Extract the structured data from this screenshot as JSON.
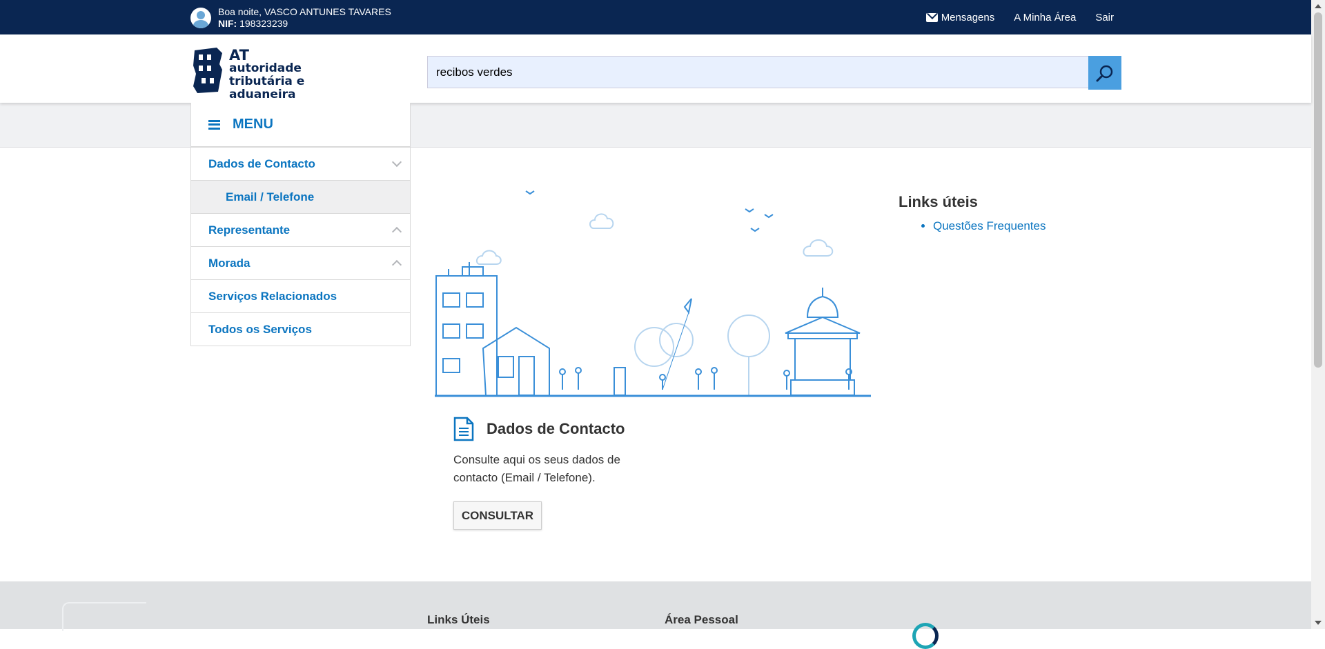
{
  "topbar": {
    "greeting": "Boa noite, VASCO ANTUNES TAVARES",
    "nif_label": "NIF:",
    "nif_value": "198323239",
    "nav": {
      "messages": "Mensagens",
      "my_area": "A Minha Área",
      "logout": "Sair"
    }
  },
  "header": {
    "logo": {
      "line1": "AT",
      "line2": "autoridade",
      "line3": "tributária e aduaneira"
    },
    "search": {
      "value": "recibos verdes",
      "icon": "search-icon"
    }
  },
  "menu": {
    "title": "MENU",
    "items": [
      {
        "label": "Dados de Contacto",
        "chevron": "down"
      },
      {
        "label": "Email / Telefone",
        "sub": true
      },
      {
        "label": "Representante",
        "chevron": "up"
      },
      {
        "label": "Morada",
        "chevron": "up"
      },
      {
        "label": "Serviços Relacionados"
      },
      {
        "label": "Todos os Serviços"
      }
    ]
  },
  "main": {
    "card": {
      "title": "Dados de Contacto",
      "description": "Consulte aqui os seus dados de contacto (Email / Telefone).",
      "button": "CONSULTAR"
    },
    "links": {
      "title": "Links úteis",
      "items": [
        "Questões Frequentes"
      ]
    }
  },
  "footer": {
    "col1": "Links Úteis",
    "col2": "Área Pessoal"
  },
  "colors": {
    "navy": "#0a2652",
    "link": "#0b75c0",
    "search_button": "#4a9fe0",
    "illustration": "#3a8fd8"
  }
}
